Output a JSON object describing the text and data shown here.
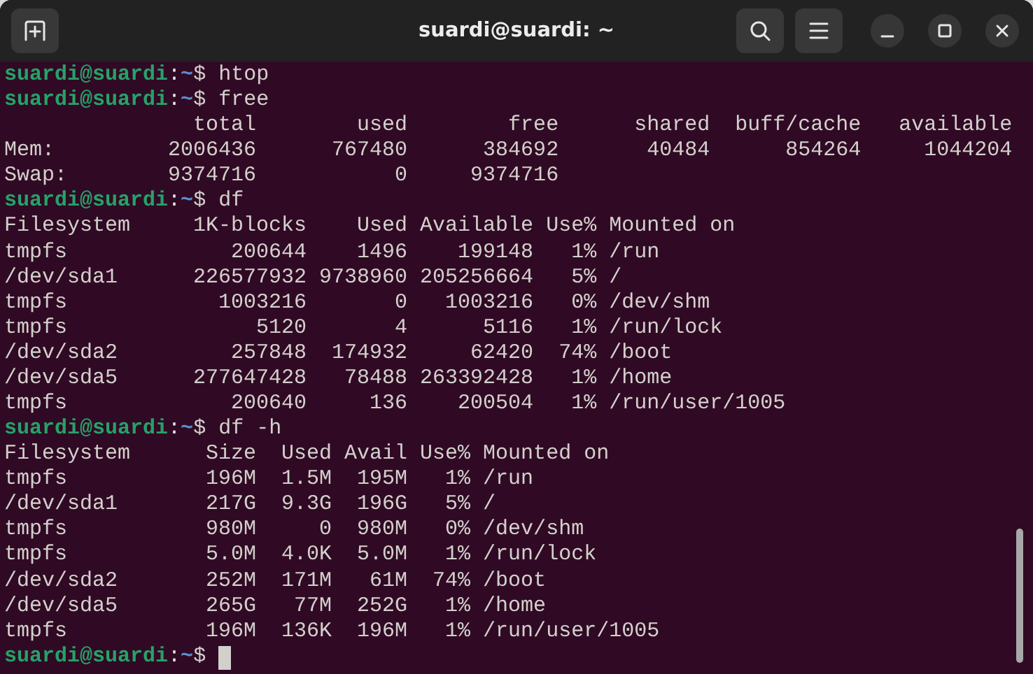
{
  "window": {
    "title": "suardi@suardi: ~"
  },
  "terminal": {
    "lines": [
      {
        "kind": "prompt",
        "user": "suardi@suardi",
        "separator": ":",
        "path": "~",
        "command": "$ htop"
      },
      {
        "kind": "prompt",
        "user": "suardi@suardi",
        "separator": ":",
        "path": "~",
        "command": "$ free"
      },
      {
        "kind": "output",
        "text": "               total        used        free      shared  buff/cache   available"
      },
      {
        "kind": "output",
        "text": "Mem:         2006436      767480      384692       40484      854264     1044204"
      },
      {
        "kind": "output",
        "text": "Swap:        9374716           0     9374716"
      },
      {
        "kind": "prompt",
        "user": "suardi@suardi",
        "separator": ":",
        "path": "~",
        "command": "$ df"
      },
      {
        "kind": "output",
        "text": "Filesystem     1K-blocks    Used Available Use% Mounted on"
      },
      {
        "kind": "output",
        "text": "tmpfs             200644    1496    199148   1% /run"
      },
      {
        "kind": "output",
        "text": "/dev/sda1      226577932 9738960 205256664   5% /"
      },
      {
        "kind": "output",
        "text": "tmpfs            1003216       0   1003216   0% /dev/shm"
      },
      {
        "kind": "output",
        "text": "tmpfs               5120       4      5116   1% /run/lock"
      },
      {
        "kind": "output",
        "text": "/dev/sda2         257848  174932     62420  74% /boot"
      },
      {
        "kind": "output",
        "text": "/dev/sda5      277647428   78488 263392428   1% /home"
      },
      {
        "kind": "output",
        "text": "tmpfs             200640     136    200504   1% /run/user/1005"
      },
      {
        "kind": "prompt",
        "user": "suardi@suardi",
        "separator": ":",
        "path": "~",
        "command": "$ df -h"
      },
      {
        "kind": "output",
        "text": "Filesystem      Size  Used Avail Use% Mounted on"
      },
      {
        "kind": "output",
        "text": "tmpfs           196M  1.5M  195M   1% /run"
      },
      {
        "kind": "output",
        "text": "/dev/sda1       217G  9.3G  196G   5% /"
      },
      {
        "kind": "output",
        "text": "tmpfs           980M     0  980M   0% /dev/shm"
      },
      {
        "kind": "output",
        "text": "tmpfs           5.0M  4.0K  5.0M   1% /run/lock"
      },
      {
        "kind": "output",
        "text": "/dev/sda2       252M  171M   61M  74% /boot"
      },
      {
        "kind": "output",
        "text": "/dev/sda5       265G   77M  252G   1% /home"
      },
      {
        "kind": "output",
        "text": "tmpfs           196M  136K  196M   1% /run/user/1005"
      },
      {
        "kind": "prompt",
        "user": "suardi@suardi",
        "separator": ":",
        "path": "~",
        "command": "$",
        "cursor": true
      }
    ]
  }
}
